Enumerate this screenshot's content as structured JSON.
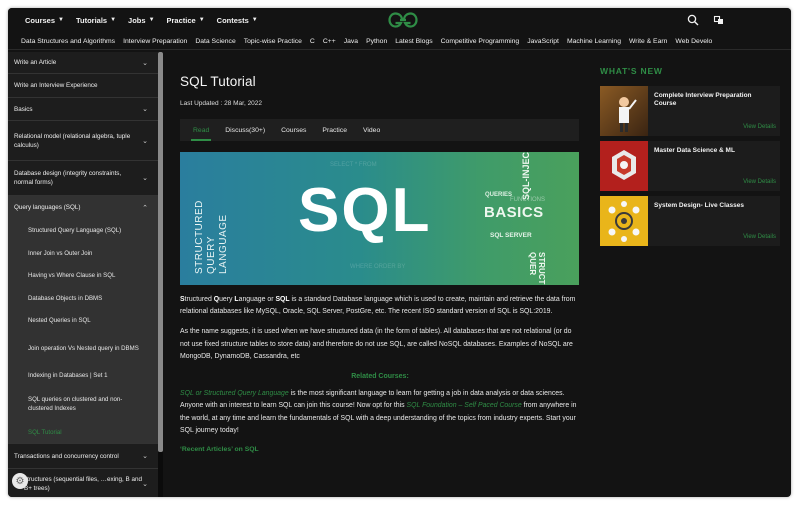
{
  "topnav": {
    "menus": [
      {
        "label": "Courses"
      },
      {
        "label": "Tutorials"
      },
      {
        "label": "Jobs"
      },
      {
        "label": "Practice"
      },
      {
        "label": "Contests"
      }
    ],
    "logo_icon": "gfg-logo-icon",
    "search_icon": "search-icon",
    "theme_icon": "theme-toggle-icon"
  },
  "categories": [
    "Data Structures and Algorithms",
    "Interview Preparation",
    "Data Science",
    "Topic-wise Practice",
    "C",
    "C++",
    "Java",
    "Python",
    "Latest Blogs",
    "Competitive Programming",
    "JavaScript",
    "Machine Learning",
    "Write & Earn",
    "Web Develo"
  ],
  "sidebar": {
    "items": [
      {
        "label": "Write an Article",
        "chevron": "⌄"
      },
      {
        "label": "Write an Interview Experience",
        "chevron": ""
      },
      {
        "label": "Basics",
        "chevron": "⌄"
      },
      {
        "label": "Relational model (relational algebra, tuple calculus)",
        "chevron": "⌄"
      },
      {
        "label": "Database design (integrity constraints, normal forms)",
        "chevron": "⌄"
      },
      {
        "label": "Query languages (SQL)",
        "chevron": "⌃"
      }
    ],
    "sub_items": [
      "Structured Query Language (SQL)",
      "Inner Join vs Outer Join",
      "Having vs Where Clause in SQL",
      "Database Objects in DBMS",
      "Nested Queries in SQL",
      "Join operation Vs Nested query in DBMS",
      "Indexing in Databases | Set 1",
      "SQL queries on clustered and non-clustered Indexes",
      "SQL Tutorial"
    ],
    "after_items": [
      {
        "label": "Transactions and concurrency control",
        "chevron": "⌄"
      },
      {
        "label": "structures (sequential files, …exing, B and B+ trees)",
        "chevron": "⌄"
      }
    ],
    "gear_icon": "settings-gear-icon"
  },
  "article": {
    "title": "SQL Tutorial",
    "updated": "Last Updated : 28 Mar, 2022",
    "tabs": [
      "Read",
      "Discuss(30+)",
      "Courses",
      "Practice",
      "Video"
    ],
    "banner": {
      "big": "SQL",
      "vertical": [
        "STRUCTURED",
        "QUERY",
        "LANGUAGE"
      ],
      "basics": "BASICS",
      "queries": "QUERIES",
      "functions": "FUNCTIONS",
      "server": "SQL SERVER",
      "injection": "SQL-INJEC",
      "structured_q": "STRUCTURED QUER"
    },
    "p1_parts": [
      "S",
      "tructured ",
      "Q",
      "uery ",
      "L",
      "anguage or ",
      "SQL",
      " is a standard Database language which is used to create, maintain and retrieve the data from relational databases like MySQL, Oracle, SQL Server, PostGre, etc. The recent ISO standard version of SQL is SQL:2019."
    ],
    "p2": "As the name suggests, it is used when we have structured data (in the form of tables). All databases that are not relational (or do not use fixed structure tables to store data) and therefore do not use SQL, are called NoSQL databases. Examples of NoSQL are MongoDB, DynamoDB, Cassandra, etc",
    "related": "Related Courses:",
    "p3_link1": "SQL or Structured Query Language",
    "p3_text1": " is the most significant language to learn for getting a job in data analysis or data sciences. Anyone with an interest to learn SQL can join this course! Now opt for this ",
    "p3_link2": "SQL Foundation – Self Paced Course",
    "p3_text2": " from anywhere in the world, at any time and learn the fundamentals of SQL with a deep understanding of the topics from industry experts. Start your SQL journey today!",
    "recent": "‘Recent Articles’ on SQL"
  },
  "whats_new": {
    "heading": "WHAT'S NEW",
    "cards": [
      {
        "title": "Complete Interview Preparation Course",
        "view": "View Details",
        "thumb_icon": "interview-prep-thumbnail"
      },
      {
        "title": "Master Data Science & ML",
        "view": "View Details",
        "thumb_icon": "data-science-thumbnail"
      },
      {
        "title": "System Design- Live Classes",
        "view": "View Details",
        "thumb_icon": "system-design-thumbnail"
      }
    ]
  },
  "colors": {
    "accent": "#2f8d46",
    "background": "#131313",
    "sidebar": "#1d1d1d"
  }
}
